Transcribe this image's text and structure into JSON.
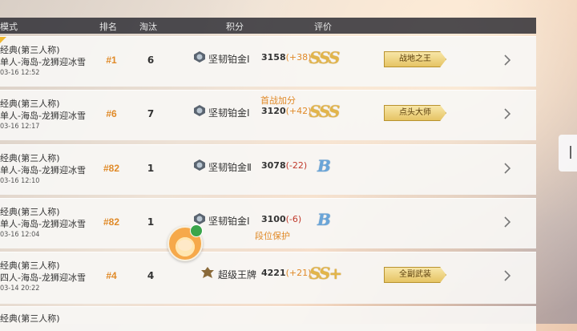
{
  "header": {
    "mode": "模式",
    "rank": "排名",
    "elim": "淘汰",
    "score": "积分",
    "rating": "评价"
  },
  "rows": [
    {
      "mode": "经典(第三人称)",
      "map": "单人-海岛-龙狮迎冰雪",
      "time": "03-16 12:52",
      "rank": "#1",
      "elim": "6",
      "tier": "坚韧铂金Ⅰ",
      "score": "3158",
      "delta": "(+38)",
      "grade": "SSS",
      "badge": "战地之王"
    },
    {
      "mode": "经典(第三人称)",
      "map": "单人-海岛-龙狮迎冰雪",
      "time": "03-16 12:17",
      "rank": "#6",
      "elim": "7",
      "tier": "坚韧铂金Ⅰ",
      "score": "3120",
      "delta": "(+42)",
      "note": "首战加分",
      "grade": "SSS",
      "badge": "点头大师"
    },
    {
      "mode": "经典(第三人称)",
      "map": "单人-海岛-龙狮迎冰雪",
      "time": "03-16 12:10",
      "rank": "#82",
      "elim": "1",
      "tier": "坚韧铂金Ⅱ",
      "score": "3078",
      "delta": "(-22)",
      "grade": "B"
    },
    {
      "mode": "经典(第三人称)",
      "map": "单人-海岛-龙狮迎冰雪",
      "time": "03-16 12:04",
      "rank": "#82",
      "elim": "1",
      "tier": "坚韧铂金Ⅰ",
      "score": "3100",
      "delta": "(-6)",
      "note": "段位保护",
      "grade": "B"
    },
    {
      "mode": "经典(第三人称)",
      "map": "四人-海岛-龙狮迎冰雪",
      "time": "03-14 20:22",
      "rank": "#4",
      "elim": "4",
      "tier": "超级王牌",
      "score": "4221",
      "delta": "(+21)",
      "grade": "SS+",
      "badge": "全副武装"
    },
    {
      "mode": "经典(第三人称)"
    }
  ],
  "colors": {
    "accent_orange": "#e08a28",
    "gold_grade": "#e2b54a",
    "blue_grade": "#6aa5d8",
    "header_bg": "#28282f"
  }
}
